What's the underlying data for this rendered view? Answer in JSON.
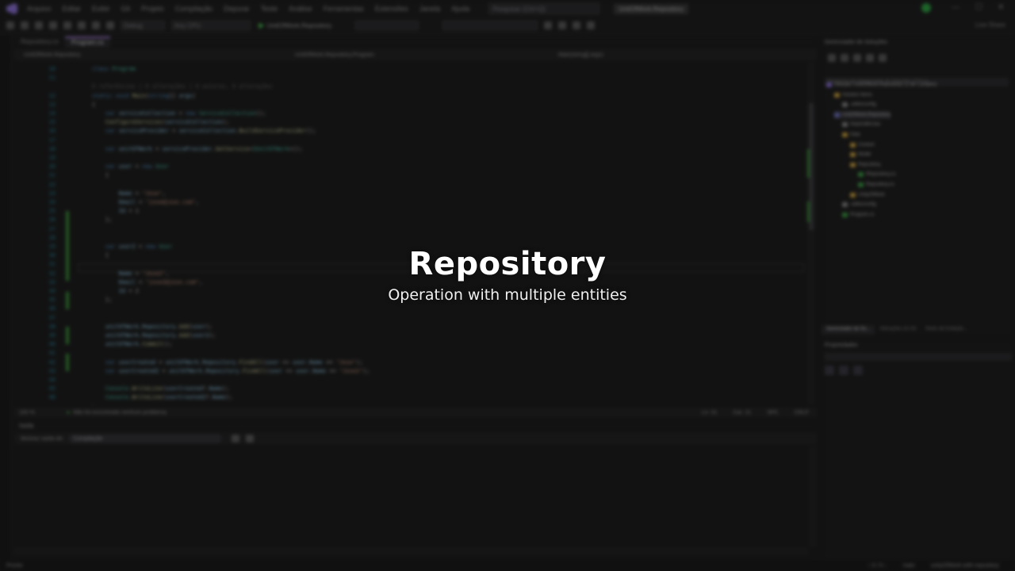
{
  "overlay": {
    "title": "Repository",
    "subtitle": "Operation with multiple entities"
  },
  "ide": {
    "menu": [
      "Arquivo",
      "Editar",
      "Exibir",
      "Git",
      "Projeto",
      "Compilação",
      "Depurar",
      "Teste",
      "Análise",
      "Ferramentas",
      "Extensões",
      "Janela",
      "Ajuda"
    ],
    "search_placeholder": "Pesquisar (Ctrl+Q)",
    "project_title": "UnitOfWork.Repository",
    "toolbar": {
      "config": "Debug",
      "platform": "Any CPU",
      "run_target": "UnitOfWork.Repository",
      "live_share": "Live Share"
    },
    "doc_tabs": [
      "Repository.cs",
      "Program.cs"
    ],
    "nav": {
      "project": "UnitOfWork.Repository",
      "type": "UnitOfWork.Repository.Program",
      "member": "Main(string[] args)"
    },
    "code_lines": [
      {
        "n": "10",
        "tokens": [
          [
            "kw",
            "class "
          ],
          [
            "ty",
            "Program"
          ]
        ]
      },
      {
        "n": "11",
        "tokens": []
      },
      {
        "n": "",
        "tokens": [
          [
            "cm",
            "0 referências | 0 alterações | 0 autores, 0 alterações"
          ]
        ]
      },
      {
        "n": "12",
        "tokens": [
          [
            "kw",
            "static void "
          ],
          [
            "fn",
            "Main"
          ],
          [
            "pl",
            "("
          ],
          [
            "kw",
            "string"
          ],
          [
            "pl",
            "[] "
          ],
          [
            "id",
            "args"
          ],
          [
            "pl",
            ")"
          ]
        ]
      },
      {
        "n": "13",
        "tokens": [
          [
            "pl",
            "{"
          ]
        ]
      },
      {
        "n": "14",
        "tokens": [
          [
            "kw",
            "    var "
          ],
          [
            "id",
            "serviceCollection"
          ],
          [
            "pl",
            " = "
          ],
          [
            "kw",
            "new "
          ],
          [
            "ty",
            "ServiceCollection"
          ],
          [
            "pl",
            "();"
          ]
        ]
      },
      {
        "n": "15",
        "tokens": [
          [
            "fn",
            "    ConfigureServices"
          ],
          [
            "pl",
            "("
          ],
          [
            "id",
            "serviceCollection"
          ],
          [
            "pl",
            ");"
          ]
        ]
      },
      {
        "n": "16",
        "tokens": [
          [
            "kw",
            "    var "
          ],
          [
            "id",
            "serviceProvider"
          ],
          [
            "pl",
            " = "
          ],
          [
            "id",
            "serviceCollection"
          ],
          [
            "pl",
            "."
          ],
          [
            "fn",
            "BuildServiceProvider"
          ],
          [
            "pl",
            "();"
          ]
        ]
      },
      {
        "n": "17",
        "tokens": []
      },
      {
        "n": "18",
        "tokens": [
          [
            "kw",
            "    var "
          ],
          [
            "id",
            "unitOfWork"
          ],
          [
            "pl",
            " = "
          ],
          [
            "id",
            "serviceProvider"
          ],
          [
            "pl",
            "."
          ],
          [
            "fn",
            "GetService"
          ],
          [
            "pl",
            "<"
          ],
          [
            "ty",
            "IUnitOfWork"
          ],
          [
            "pl",
            ">();"
          ]
        ]
      },
      {
        "n": "19",
        "tokens": []
      },
      {
        "n": "20",
        "tokens": [
          [
            "kw",
            "    var "
          ],
          [
            "id",
            "user"
          ],
          [
            "pl",
            " = "
          ],
          [
            "kw",
            "new "
          ],
          [
            "ty",
            "User"
          ]
        ]
      },
      {
        "n": "21",
        "tokens": [
          [
            "pl",
            "    {"
          ]
        ]
      },
      {
        "n": "22",
        "tokens": []
      },
      {
        "n": "23",
        "tokens": [
          [
            "id",
            "        Name"
          ],
          [
            "pl",
            " = "
          ],
          [
            "st",
            "\"Jose\""
          ],
          [
            "pl",
            ","
          ]
        ]
      },
      {
        "n": "24",
        "tokens": [
          [
            "id",
            "        Email"
          ],
          [
            "pl",
            " = "
          ],
          [
            "st",
            "\"jose@jose.com\""
          ],
          [
            "pl",
            ","
          ]
        ]
      },
      {
        "n": "25",
        "tokens": [
          [
            "id",
            "        Id"
          ],
          [
            "pl",
            " = 1"
          ]
        ]
      },
      {
        "n": "26",
        "tokens": [
          [
            "pl",
            "    };"
          ]
        ]
      },
      {
        "n": "27",
        "tokens": []
      },
      {
        "n": "28",
        "tokens": []
      },
      {
        "n": "29",
        "tokens": [
          [
            "kw",
            "    var "
          ],
          [
            "id",
            "user2"
          ],
          [
            "pl",
            " = "
          ],
          [
            "kw",
            "new "
          ],
          [
            "ty",
            "User"
          ]
        ]
      },
      {
        "n": "30",
        "tokens": [
          [
            "pl",
            "    {"
          ]
        ]
      },
      {
        "n": "31",
        "tokens": []
      },
      {
        "n": "32",
        "tokens": [
          [
            "id",
            "        Name"
          ],
          [
            "pl",
            " = "
          ],
          [
            "st",
            "\"Jose2\""
          ],
          [
            "pl",
            ","
          ]
        ]
      },
      {
        "n": "33",
        "tokens": [
          [
            "id",
            "        Email"
          ],
          [
            "pl",
            " = "
          ],
          [
            "st",
            "\"jose2@jose.com\""
          ],
          [
            "pl",
            ","
          ]
        ]
      },
      {
        "n": "34",
        "tokens": [
          [
            "id",
            "        Id"
          ],
          [
            "pl",
            " = 2"
          ]
        ]
      },
      {
        "n": "35",
        "tokens": [
          [
            "pl",
            "    };"
          ]
        ]
      },
      {
        "n": "36",
        "tokens": []
      },
      {
        "n": "37",
        "tokens": []
      },
      {
        "n": "38",
        "tokens": [
          [
            "id",
            "    unitOfWork"
          ],
          [
            "pl",
            "."
          ],
          [
            "id",
            "Repository"
          ],
          [
            "pl",
            "."
          ],
          [
            "fn",
            "Add"
          ],
          [
            "pl",
            "("
          ],
          [
            "id",
            "user"
          ],
          [
            "pl",
            ");"
          ]
        ]
      },
      {
        "n": "39",
        "tokens": [
          [
            "id",
            "    unitOfWork"
          ],
          [
            "pl",
            "."
          ],
          [
            "id",
            "Repository"
          ],
          [
            "pl",
            "."
          ],
          [
            "fn",
            "Add"
          ],
          [
            "pl",
            "("
          ],
          [
            "id",
            "user2"
          ],
          [
            "pl",
            ");"
          ]
        ]
      },
      {
        "n": "40",
        "tokens": [
          [
            "id",
            "    unitOfWork"
          ],
          [
            "pl",
            "."
          ],
          [
            "fn",
            "Commit"
          ],
          [
            "pl",
            "();"
          ]
        ]
      },
      {
        "n": "41",
        "tokens": []
      },
      {
        "n": "42",
        "tokens": [
          [
            "kw",
            "    var "
          ],
          [
            "id",
            "userCreated"
          ],
          [
            "pl",
            " = "
          ],
          [
            "id",
            "unitOfWork"
          ],
          [
            "pl",
            "."
          ],
          [
            "id",
            "Repository"
          ],
          [
            "pl",
            "."
          ],
          [
            "fn",
            "FindAll"
          ],
          [
            "pl",
            "("
          ],
          [
            "id",
            "user"
          ],
          [
            "pl",
            " => "
          ],
          [
            "id",
            "user"
          ],
          [
            "pl",
            "."
          ],
          [
            "id",
            "Name"
          ],
          [
            "pl",
            " == "
          ],
          [
            "st",
            "\"Jose\""
          ],
          [
            "pl",
            ");"
          ]
        ]
      },
      {
        "n": "43",
        "tokens": [
          [
            "kw",
            "    var "
          ],
          [
            "id",
            "userCreated2"
          ],
          [
            "pl",
            " = "
          ],
          [
            "id",
            "unitOfWork"
          ],
          [
            "pl",
            "."
          ],
          [
            "id",
            "Repository"
          ],
          [
            "pl",
            "."
          ],
          [
            "fn",
            "FindAll"
          ],
          [
            "pl",
            "("
          ],
          [
            "id",
            "user"
          ],
          [
            "pl",
            " => "
          ],
          [
            "id",
            "user"
          ],
          [
            "pl",
            "."
          ],
          [
            "id",
            "Name"
          ],
          [
            "pl",
            " == "
          ],
          [
            "st",
            "\"Jose2\""
          ],
          [
            "pl",
            ");"
          ]
        ]
      },
      {
        "n": "44",
        "tokens": []
      },
      {
        "n": "45",
        "tokens": [
          [
            "ty",
            "    Console"
          ],
          [
            "pl",
            "."
          ],
          [
            "fn",
            "WriteLine"
          ],
          [
            "pl",
            "("
          ],
          [
            "id",
            "userCreated"
          ],
          [
            "pl",
            "?."
          ],
          [
            "id",
            "Name"
          ],
          [
            "pl",
            ");"
          ]
        ]
      },
      {
        "n": "46",
        "tokens": [
          [
            "ty",
            "    Console"
          ],
          [
            "pl",
            "."
          ],
          [
            "fn",
            "WriteLine"
          ],
          [
            "pl",
            "("
          ],
          [
            "id",
            "userCreated2"
          ],
          [
            "pl",
            "?."
          ],
          [
            "id",
            "Name"
          ],
          [
            "pl",
            ");"
          ]
        ]
      },
      {
        "n": "47",
        "tokens": [
          [
            "pl",
            "}"
          ]
        ]
      },
      {
        "n": "",
        "tokens": []
      },
      {
        "n": "",
        "tokens": [
          [
            "cm",
            "1 referência | 0 alterações | 0 autores, 0 alterações"
          ]
        ]
      },
      {
        "n": "48",
        "tokens": [
          [
            "kw",
            "static void "
          ],
          [
            "fn",
            "ConfigureServices"
          ],
          [
            "pl",
            "("
          ],
          [
            "ty",
            "IServiceCollection"
          ],
          [
            "pl",
            " "
          ],
          [
            "id",
            "services"
          ],
          [
            "pl",
            ")"
          ]
        ]
      }
    ],
    "editor_status": {
      "zoom": "100 %",
      "issues": "Não foi encontrado nenhum problema",
      "line": "Ln: 31",
      "col": "Car: 21",
      "spc": "SPC",
      "crlf": "CRLF"
    },
    "output": {
      "title": "Saída",
      "show_from_label": "Mostrar saída de:",
      "source": "Compilação"
    },
    "solution_explorer": {
      "title": "Gerenciador de Soluções",
      "search_placeholder": "Pesquisar em Gerenciador de Soluções (Ctrl+ç)",
      "items": [
        {
          "label": "Solução 'UnitOfWork.Repository' (1 de 1 projeto)",
          "icon": "sln",
          "depth": 0
        },
        {
          "label": "Solution Items",
          "icon": "folder",
          "depth": 1
        },
        {
          "label": ".editorconfig",
          "icon": "file",
          "depth": 2
        },
        {
          "label": "UnitOfWork.Repository",
          "icon": "proj",
          "depth": 1,
          "selected": true
        },
        {
          "label": "Dependências",
          "icon": "file",
          "depth": 2
        },
        {
          "label": "Data",
          "icon": "folder",
          "depth": 2
        },
        {
          "label": "Context",
          "icon": "folder",
          "depth": 3
        },
        {
          "label": "Model",
          "icon": "folder",
          "depth": 3
        },
        {
          "label": "Repository",
          "icon": "folder",
          "depth": 3
        },
        {
          "label": "IRepository.cs",
          "icon": "cs",
          "depth": 4
        },
        {
          "label": "Repository.cs",
          "icon": "cs",
          "depth": 4
        },
        {
          "label": "UnityOfWork",
          "icon": "folder",
          "depth": 3
        },
        {
          "label": ".editorconfig",
          "icon": "file",
          "depth": 2
        },
        {
          "label": "Program.cs",
          "icon": "cs",
          "depth": 2
        }
      ]
    },
    "panel_tabs": [
      "Gerenciador de So...",
      "Alterações do Git",
      "Modo de Exibição..."
    ],
    "properties": {
      "title": "Propriedades"
    },
    "statusbar": {
      "left": "Pronto",
      "position": "↑ 0 / 0 ↓",
      "branch": "unityOfWork-with-repository",
      "repo": "main"
    }
  }
}
